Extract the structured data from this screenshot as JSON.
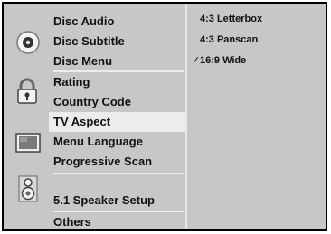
{
  "menu": {
    "items": [
      {
        "label": "Disc Audio"
      },
      {
        "label": "Disc Subtitle"
      },
      {
        "label": "Disc Menu"
      },
      {
        "label": "Rating"
      },
      {
        "label": "Country Code"
      },
      {
        "label": "TV Aspect"
      },
      {
        "label": "Menu Language"
      },
      {
        "label": "Progressive Scan"
      },
      {
        "label": "5.1 Speaker Setup"
      },
      {
        "label": "Others"
      }
    ],
    "selected": "TV Aspect"
  },
  "options": {
    "items": [
      {
        "label": "4:3 Letterbox",
        "checked": false
      },
      {
        "label": "4:3 Panscan",
        "checked": false
      },
      {
        "label": "16:9 Wide",
        "checked": true
      }
    ],
    "check_glyph": "✓"
  },
  "icons": {
    "disc": "disc-icon",
    "lock": "lock-icon",
    "screen": "screen-icon",
    "speaker": "speaker-icon"
  }
}
